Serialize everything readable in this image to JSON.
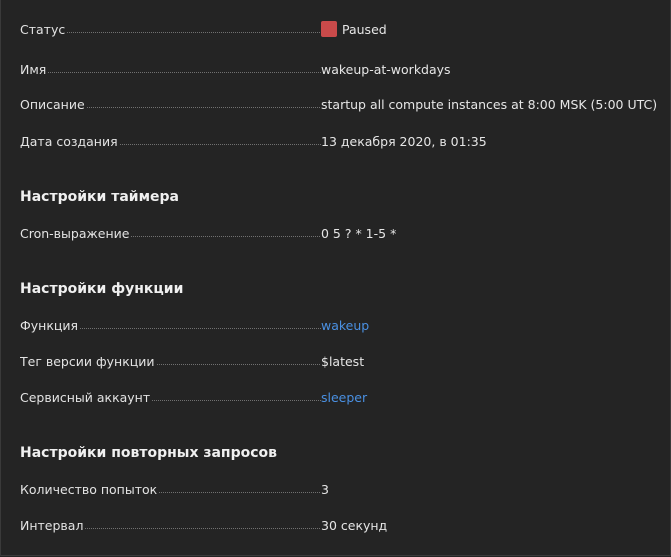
{
  "status": {
    "label": "Статус",
    "value": "Paused",
    "color": "#c94a4a"
  },
  "name": {
    "label": "Имя",
    "value": "wakeup-at-workdays"
  },
  "description": {
    "label": "Описание",
    "value": "startup all compute instances at 8:00 MSK (5:00 UTC)"
  },
  "created": {
    "label": "Дата создания",
    "value": "13 декабря 2020, в 01:35"
  },
  "timer_settings": {
    "title": "Настройки таймера",
    "cron_label": "Cron-выражение",
    "cron_value": "0 5 ? * 1-5 *"
  },
  "function_settings": {
    "title": "Настройки функции",
    "function_label": "Функция",
    "function_value": "wakeup",
    "version_tag_label": "Тег версии функции",
    "version_tag_value": "$latest",
    "service_account_label": "Сервисный аккаунт",
    "service_account_value": "sleeper"
  },
  "retry_settings": {
    "title": "Настройки повторных запросов",
    "attempts_label": "Количество попыток",
    "attempts_value": "3",
    "interval_label": "Интервал",
    "interval_value": "30 секунд"
  },
  "colors": {
    "background": "#242424",
    "text": "#e3e3e3",
    "link": "#4a90e2"
  }
}
